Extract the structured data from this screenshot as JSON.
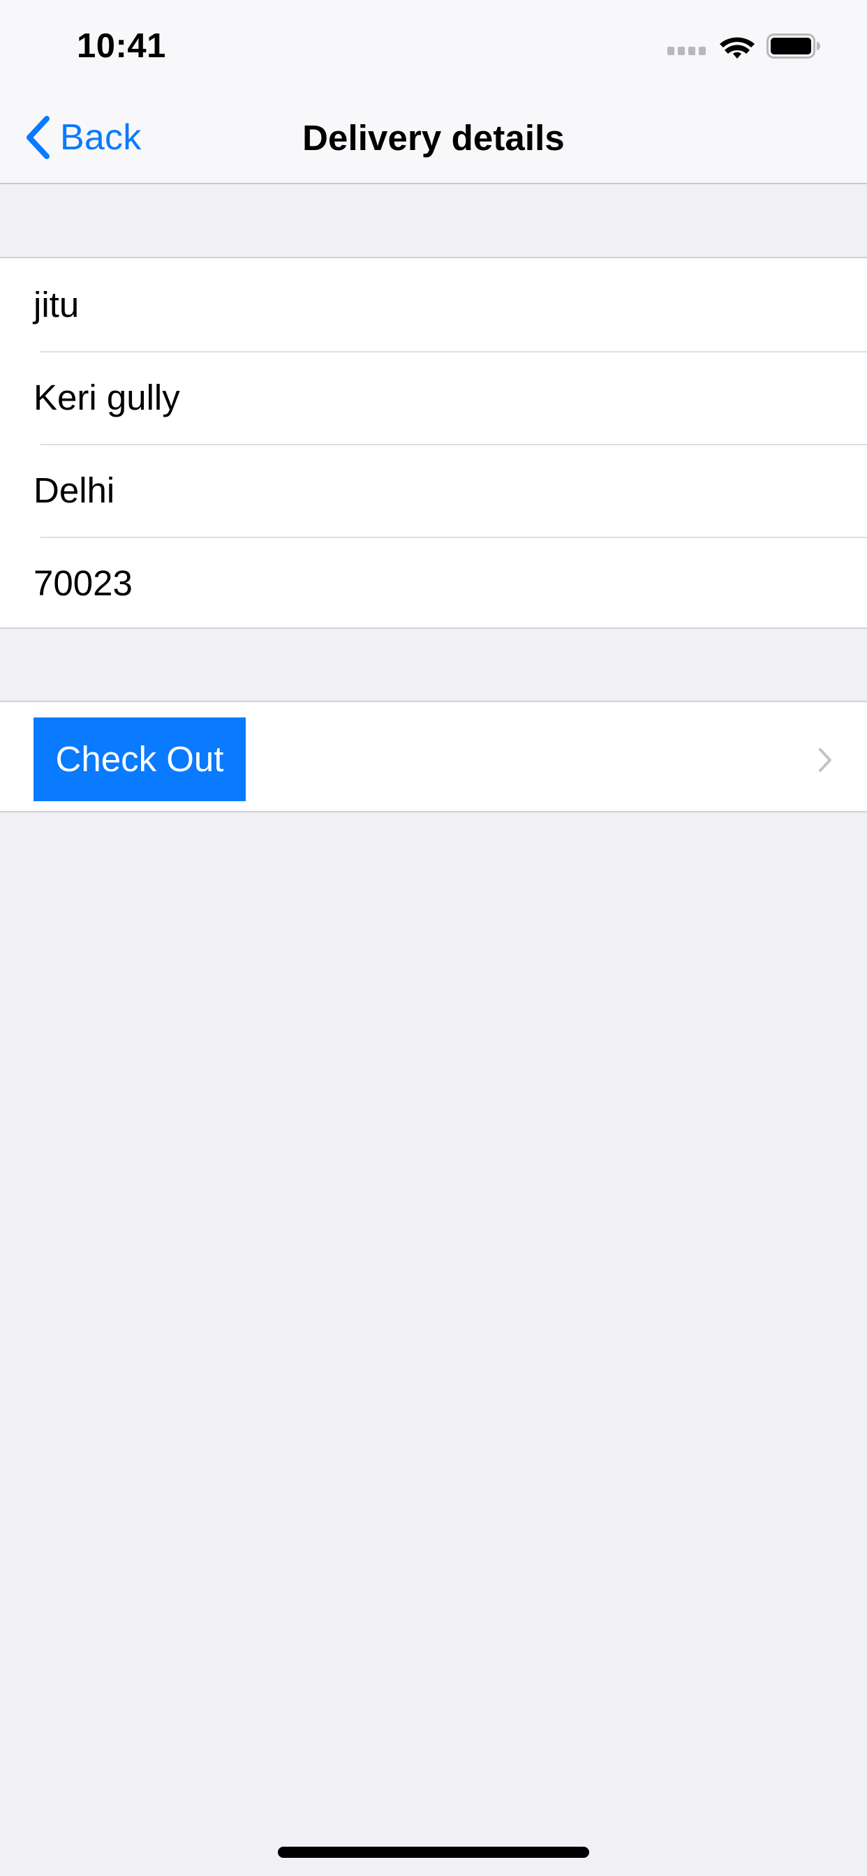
{
  "status_bar": {
    "time": "10:41"
  },
  "navigation": {
    "back_label": "Back",
    "title": "Delivery details"
  },
  "delivery_form": {
    "fields": [
      {
        "value": "jitu"
      },
      {
        "value": "Keri gully"
      },
      {
        "value": "Delhi"
      },
      {
        "value": "70023"
      }
    ]
  },
  "actions": {
    "checkout_label": "Check Out"
  },
  "colors": {
    "accent": "#0a7aff",
    "background": "#f0f0f5",
    "surface": "#ffffff",
    "separator": "#d1d1d6"
  },
  "icons": {
    "back": "chevron-left-icon",
    "disclosure": "chevron-right-icon",
    "wifi": "wifi-icon",
    "battery": "battery-icon",
    "signal": "signal-icon"
  }
}
